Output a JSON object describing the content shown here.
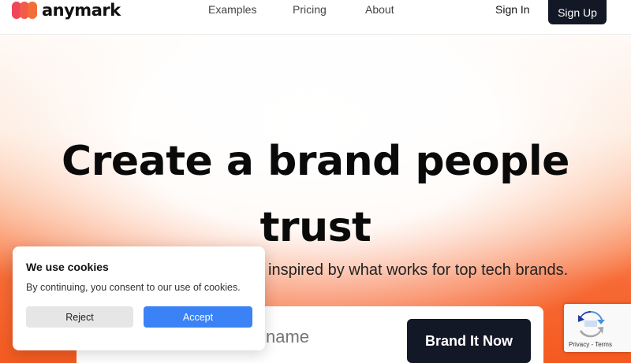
{
  "brand": {
    "name": "anymark",
    "logo_colors": [
      "#f0455a",
      "#f25a4a",
      "#f36d3b"
    ]
  },
  "nav": {
    "items": [
      {
        "label": "Examples"
      },
      {
        "label": "Pricing"
      },
      {
        "label": "About"
      }
    ],
    "signin_label": "Sign In",
    "signup_label": "Sign Up"
  },
  "hero": {
    "headline": "Create a brand people trust",
    "subtitle_visible": "inspired by what works for top tech brands.",
    "input_placeholder": "name",
    "cta_label": "Brand It Now",
    "gradient_colors": [
      "#fff7f2",
      "#fba57a",
      "#f45a20"
    ]
  },
  "cookie_banner": {
    "title": "We use cookies",
    "text": "By continuing, you consent to our use of cookies.",
    "reject_label": "Reject",
    "accept_label": "Accept",
    "accept_color": "#3b82f6"
  },
  "recaptcha": {
    "icon": "recaptcha-icon",
    "links": "Privacy - Terms"
  },
  "colors": {
    "dark_button": "#121826"
  }
}
